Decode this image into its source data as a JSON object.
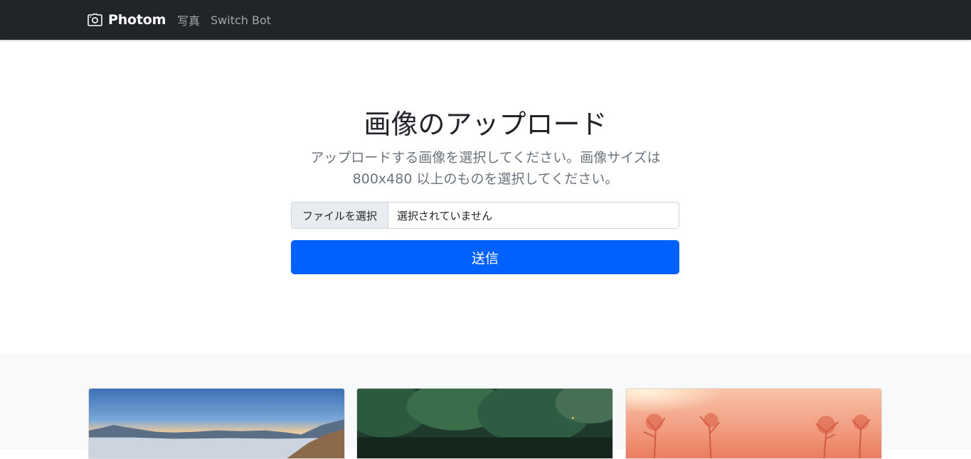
{
  "navbar": {
    "brand": "Photom",
    "brand_icon": "camera-icon",
    "links": [
      "写真",
      "Switch Bot"
    ]
  },
  "hero": {
    "title": "画像のアップロード",
    "lead_line1": "アップロードする画像を選択してください。画像サイズは",
    "lead_line2": "800x480 以上のものを選択してください。"
  },
  "upload_form": {
    "file_button_label": "ファイルを選択",
    "file_status": "選択されていません",
    "submit_label": "送信"
  },
  "colors": {
    "navbar_bg": "#212529",
    "primary": "#0061fe",
    "gallery_bg": "#f8f9fa"
  },
  "gallery": {
    "photos": [
      "mountain-sunrise-photo",
      "forest-photo",
      "red-misty-trees-photo"
    ]
  }
}
